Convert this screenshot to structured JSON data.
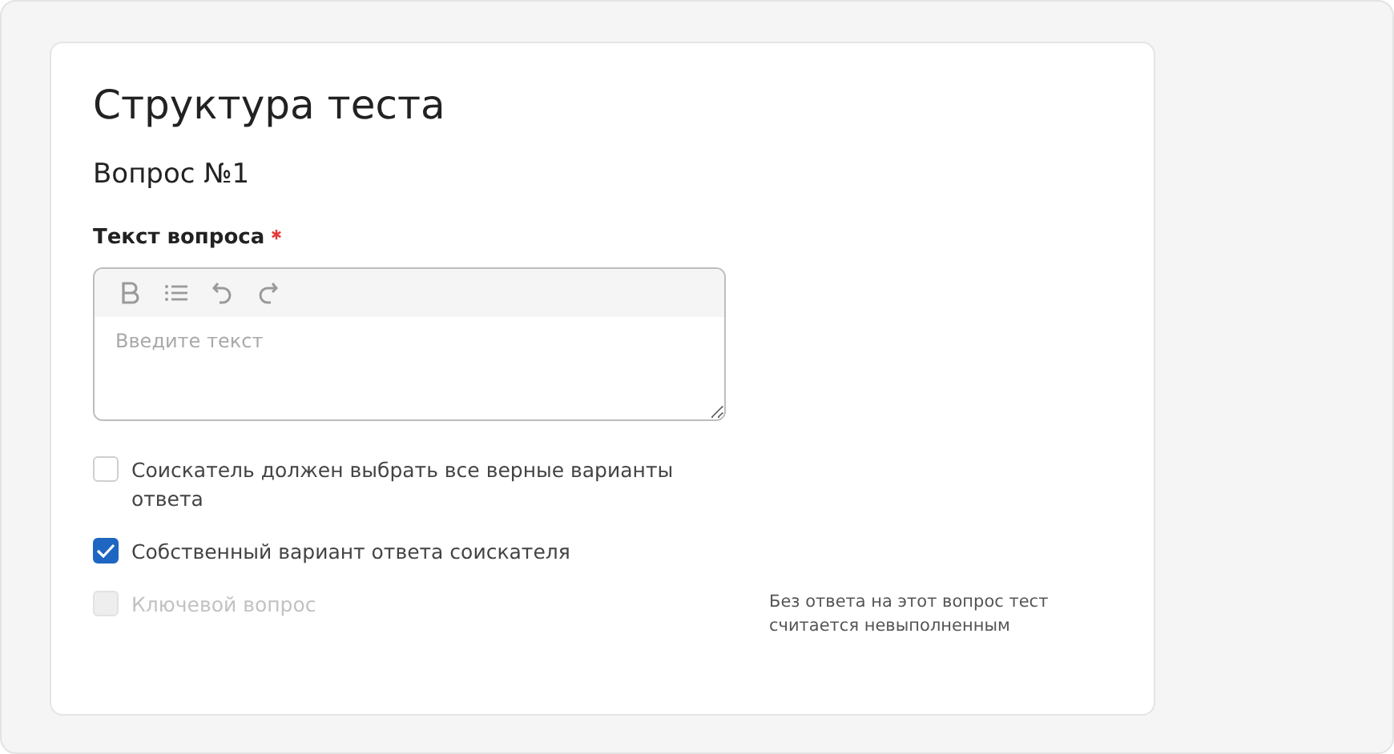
{
  "title": "Структура теста",
  "question_heading": "Вопрос №1",
  "field": {
    "label": "Текст вопроса",
    "required": true,
    "placeholder": "Введите текст"
  },
  "options": [
    {
      "label": "Соискатель должен выбрать все верные варианты ответа",
      "checked": false,
      "disabled": false
    },
    {
      "label": "Собственный вариант ответа соискателя",
      "checked": true,
      "disabled": false
    },
    {
      "label": "Ключевой вопрос",
      "checked": false,
      "disabled": true,
      "hint": "Без ответа на этот вопрос тест считается невыполненным"
    }
  ]
}
